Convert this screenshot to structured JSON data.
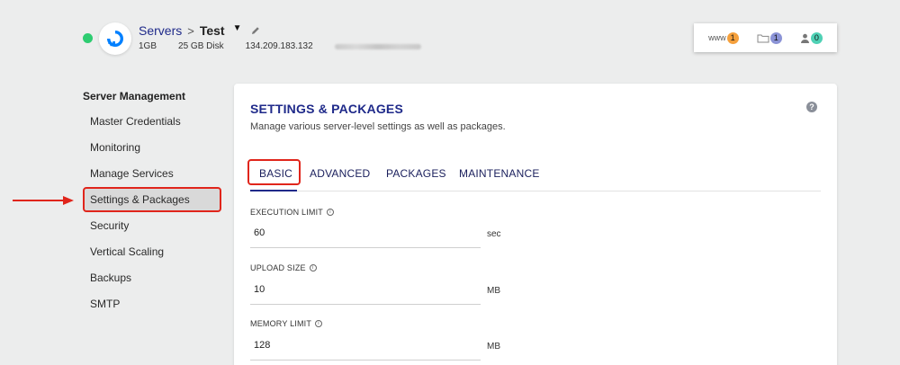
{
  "header": {
    "breadcrumb_parent": "Servers",
    "breadcrumb_separator": ">",
    "server_name": "Test",
    "specs": [
      "1GB",
      "25 GB Disk",
      "134.209.183.132"
    ],
    "status_color": "#2ecc71"
  },
  "top_card": {
    "www_label": "www",
    "www_count": "1",
    "files_count": "1",
    "users_count": "0",
    "colors": {
      "www": "#f5a03c",
      "files": "#8b93d6",
      "users": "#4fd1b5"
    }
  },
  "sidebar": {
    "title": "Server Management",
    "items": [
      {
        "label": "Master Credentials"
      },
      {
        "label": "Monitoring"
      },
      {
        "label": "Manage Services"
      },
      {
        "label": "Settings & Packages"
      },
      {
        "label": "Security"
      },
      {
        "label": "Vertical Scaling"
      },
      {
        "label": "Backups"
      },
      {
        "label": "SMTP"
      }
    ],
    "active_index": 3
  },
  "main": {
    "title": "SETTINGS & PACKAGES",
    "subtitle": "Manage various server-level settings as well as packages.",
    "tabs": [
      {
        "label": "BASIC"
      },
      {
        "label": "ADVANCED"
      },
      {
        "label": "PACKAGES"
      },
      {
        "label": "MAINTENANCE"
      }
    ],
    "fields": [
      {
        "label": "EXECUTION LIMIT",
        "value": "60",
        "unit": "sec"
      },
      {
        "label": "UPLOAD SIZE",
        "value": "10",
        "unit": "MB"
      },
      {
        "label": "MEMORY LIMIT",
        "value": "128",
        "unit": "MB"
      }
    ]
  },
  "colors": {
    "accent": "#1f2a8a",
    "highlight": "#e0251b"
  }
}
